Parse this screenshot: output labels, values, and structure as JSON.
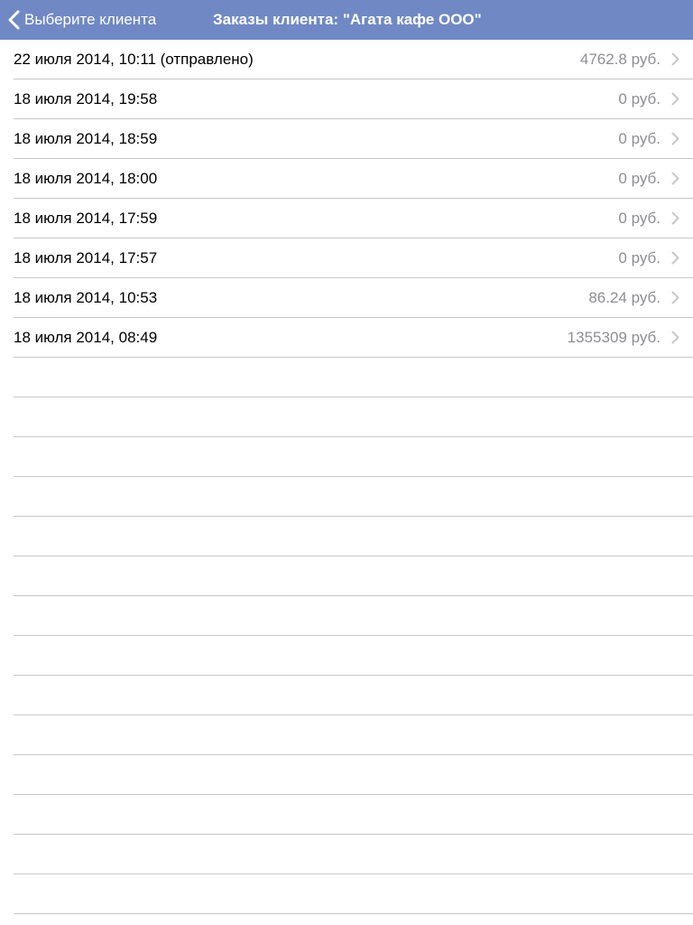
{
  "navbar": {
    "back_label": "Выберите клиента",
    "title": "Заказы клиента: \"Агата кафе ООО\""
  },
  "orders": [
    {
      "date": "22 июля 2014, 10:11 (отправлено)",
      "amount": "4762.8 руб."
    },
    {
      "date": "18 июля 2014, 19:58",
      "amount": "0 руб."
    },
    {
      "date": "18 июля 2014, 18:59",
      "amount": "0 руб."
    },
    {
      "date": "18 июля 2014, 18:00",
      "amount": "0 руб."
    },
    {
      "date": "18 июля 2014, 17:59",
      "amount": "0 руб."
    },
    {
      "date": "18 июля 2014, 17:57",
      "amount": "0 руб."
    },
    {
      "date": "18 июля 2014, 10:53",
      "amount": "86.24 руб."
    },
    {
      "date": "18 июля 2014, 08:49",
      "amount": "1355309 руб."
    }
  ],
  "icons": {
    "back": "chevron-left-icon",
    "disclosure": "chevron-right-icon"
  },
  "colors": {
    "navbar": "#7089c4",
    "separator": "#c8c7cc",
    "amount_text": "#8e8e93",
    "chevron": "#c7c7cc"
  }
}
